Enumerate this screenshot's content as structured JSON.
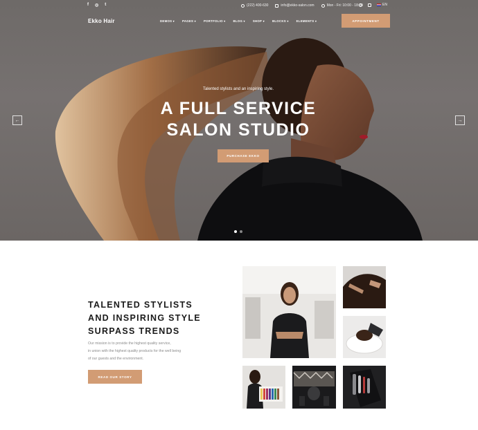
{
  "brand": {
    "logo": "Ekko Hair",
    "accent": "#d29c74"
  },
  "topbar": {
    "social": [
      {
        "icon": "facebook-icon",
        "glyph": "f"
      },
      {
        "icon": "instagram-icon",
        "glyph": "◎"
      },
      {
        "icon": "twitter-icon",
        "glyph": "t"
      }
    ],
    "phone": "(222) 400-630",
    "email": "info@ekko-salon.com",
    "hours": "Mon - Fri: 10:00 - 18:00",
    "language": "EN"
  },
  "nav": {
    "items": [
      "DEMOS",
      "PAGES",
      "PORTFOLIO",
      "BLOG",
      "SHOP",
      "BLOCKS",
      "ELEMENTS"
    ],
    "cta": "APPOINTMENT"
  },
  "hero": {
    "tagline": "Talented stylists and an inspiring style.",
    "headline_line1": "A FULL SERVICE",
    "headline_line2": "SALON STUDIO",
    "button": "PURCHASE EKKO",
    "prev_glyph": "←",
    "next_glyph": "→",
    "slides": 2,
    "active_slide": 1
  },
  "about": {
    "title_line1": "TALENTED STYLISTS",
    "title_line2": "AND INSPIRING STYLE",
    "title_line3": "SURPASS TRENDS",
    "text_line1": "Our mission is to provide the highest quality service,",
    "text_line2": "in union with the highest quality products for the well being",
    "text_line3": "of our guests and the environment.",
    "button": "READ OUR STORY"
  }
}
